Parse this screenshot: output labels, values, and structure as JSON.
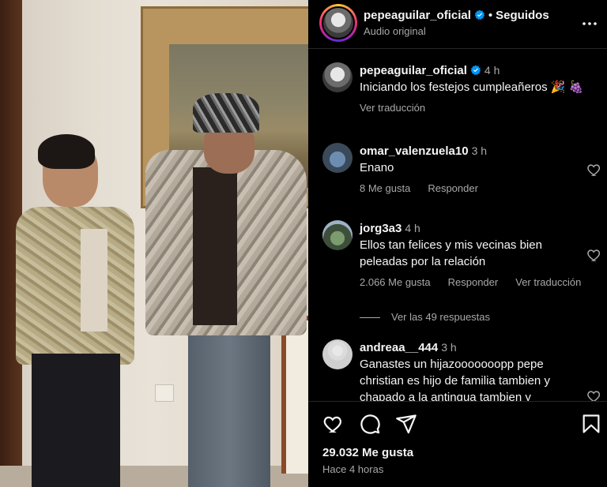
{
  "post": {
    "username": "pepeaguilar_oficial",
    "follow_status": "Seguidos",
    "separator": "•",
    "audio": "Audio original"
  },
  "caption": {
    "username": "pepeaguilar_oficial",
    "time": "4 h",
    "text": "Iniciando los festejos cumpleañeros 🎉 🍇",
    "translate": "Ver traducción"
  },
  "comments": [
    {
      "username": "omar_valenzuela10",
      "time": "3 h",
      "text": "Enano",
      "likes": "8 Me gusta",
      "reply": "Responder",
      "translate": ""
    },
    {
      "username": "jorg3a3",
      "time": "4 h",
      "text": "Ellos tan felices y mis vecinas bien peleadas por la relación",
      "likes": "2.066 Me gusta",
      "reply": "Responder",
      "translate": "Ver traducción"
    },
    {
      "username": "andreaa__444",
      "time": "3 h",
      "text": "Ganastes un hijazooooooopp pepe christian es hijo de familia tambien y chapado a la antingua tambien y",
      "likes": "",
      "reply": "",
      "translate": ""
    }
  ],
  "view_replies": "Ver las 49 respuestas",
  "footer": {
    "likes": "29.032 Me gusta",
    "time_ago": "Hace 4 horas"
  },
  "colors": {
    "background": "#000000",
    "text": "#f5f5f5",
    "secondary": "#a8a8a8",
    "verified": "#0095f6",
    "divider": "#262626"
  },
  "icons": [
    "verified-icon",
    "more-icon",
    "heart-icon",
    "comment-icon",
    "share-icon",
    "bookmark-icon"
  ]
}
